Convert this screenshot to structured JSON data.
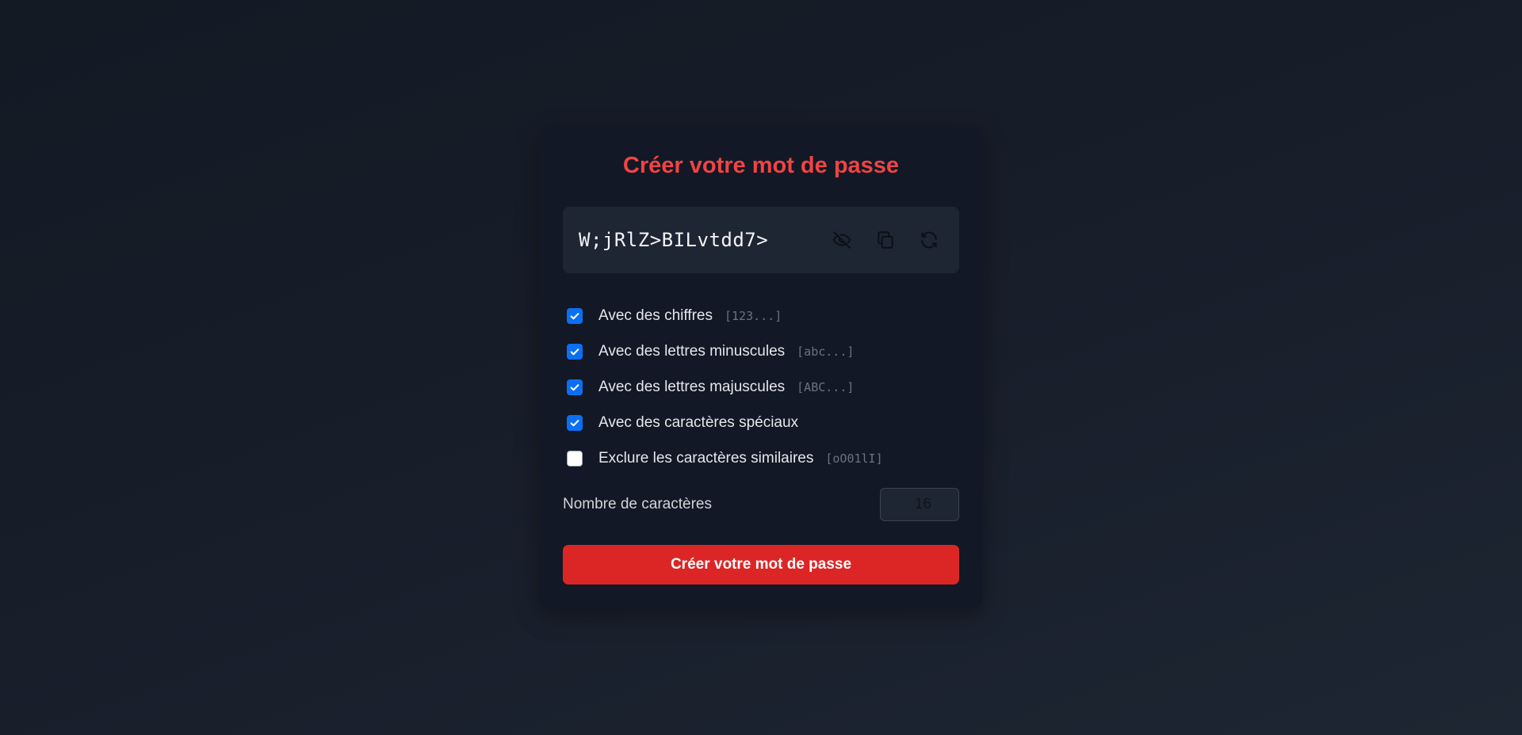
{
  "generator": {
    "title": "Créer votre mot de passe",
    "password": "W;jRlZ>BILvtdd7>",
    "actions": [
      {
        "icon": "eye-off-icon",
        "name": "toggle-visibility-button"
      },
      {
        "icon": "copy-icon",
        "name": "copy-button"
      },
      {
        "icon": "refresh-icon",
        "name": "regenerate-button"
      }
    ],
    "options": [
      {
        "label": "Avec des chiffres",
        "hint": "[123...]",
        "checked": true
      },
      {
        "label": "Avec des lettres minuscules",
        "hint": "[abc...]",
        "checked": true
      },
      {
        "label": "Avec des lettres majuscules",
        "hint": "[ABC...]",
        "checked": true
      },
      {
        "label": "Avec des caractères spéciaux",
        "hint": "",
        "checked": true
      },
      {
        "label": "Exclure les caractères similaires",
        "hint": "[oO01lI]",
        "checked": false
      }
    ],
    "length_label": "Nombre de caractères",
    "length_value": "16",
    "submit_label": "Créer votre mot de passe"
  },
  "colors": {
    "accent": "#ef4444",
    "button": "#dc2626",
    "checkbox": "#0b6ff2",
    "card": "#121825",
    "field": "#1e2533"
  }
}
